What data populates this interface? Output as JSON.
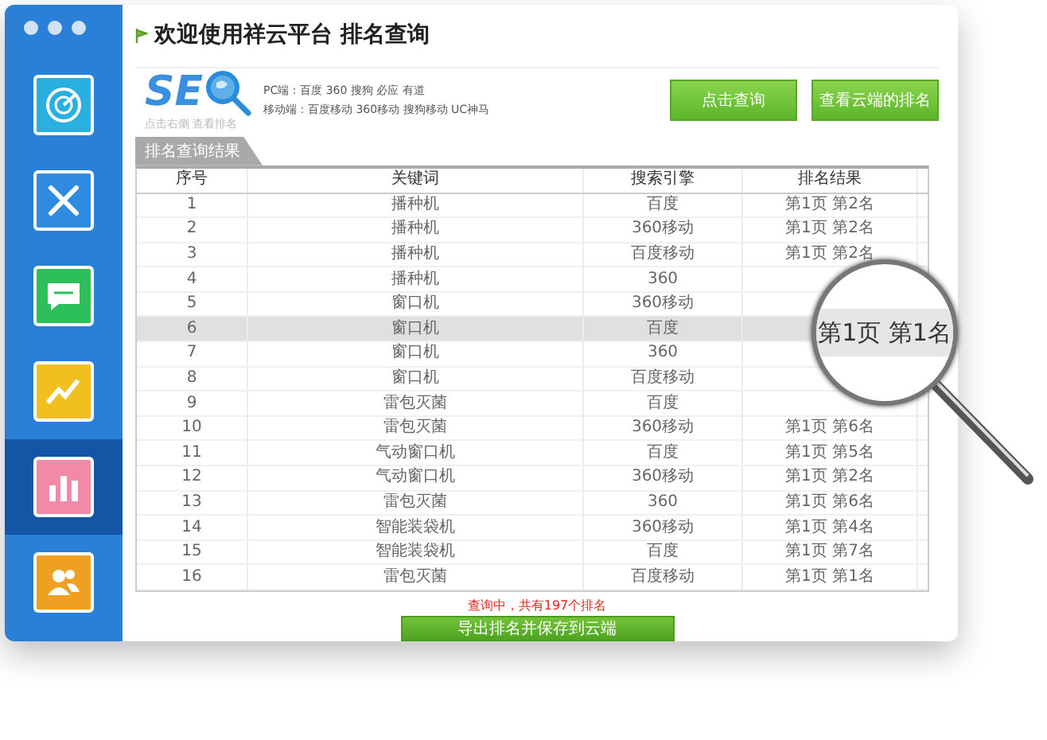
{
  "window": {
    "title": "欢迎使用祥云平台 排名查询"
  },
  "sidebar": {
    "items": [
      {
        "selected": false
      },
      {
        "selected": false
      },
      {
        "selected": false
      },
      {
        "selected": false
      },
      {
        "selected": true
      },
      {
        "selected": false
      }
    ]
  },
  "logo": {
    "text": "SE",
    "tagline": "点击右侧 查看排名"
  },
  "engines": [
    "PC端：百度 360 搜狗 必应 有道",
    "移动端：百度移动 360移动 搜狗移动 UC神马"
  ],
  "buttons": [
    "点击查询",
    "查看云端的排名"
  ],
  "tab": {
    "label": "排名查询结果"
  },
  "table": {
    "columns": [
      "序号",
      "关键词",
      "搜索引擎",
      "排名结果"
    ],
    "rows": [
      {
        "cells": [
          "1",
          "播种机",
          "百度",
          "第1页 第2名"
        ],
        "selected": false
      },
      {
        "cells": [
          "2",
          "播种机",
          "360移动",
          "第1页 第2名"
        ],
        "selected": false
      },
      {
        "cells": [
          "3",
          "播种机",
          "百度移动",
          "第1页 第2名"
        ],
        "selected": false
      },
      {
        "cells": [
          "4",
          "播种机",
          "360"
        ],
        "selected": false
      },
      {
        "cells": [
          "5",
          "窗口机",
          "360移动"
        ],
        "selected": false
      },
      {
        "cells": [
          "6",
          "窗口机",
          "百度"
        ],
        "selected": true
      },
      {
        "cells": [
          "7",
          "窗口机",
          "360"
        ],
        "selected": false
      },
      {
        "cells": [
          "8",
          "窗口机",
          "百度移动"
        ],
        "selected": false
      },
      {
        "cells": [
          "9",
          "雷包灭菌",
          "百度"
        ],
        "selected": false
      },
      {
        "cells": [
          "10",
          "雷包灭菌",
          "360移动",
          "第1页 第6名"
        ],
        "selected": false
      },
      {
        "cells": [
          "11",
          "气动窗口机",
          "百度",
          "第1页 第5名"
        ],
        "selected": false
      },
      {
        "cells": [
          "12",
          "气动窗口机",
          "360移动",
          "第1页 第2名"
        ],
        "selected": false
      },
      {
        "cells": [
          "13",
          "雷包灭菌",
          "360",
          "第1页 第6名"
        ],
        "selected": false
      },
      {
        "cells": [
          "14",
          "智能装袋机",
          "360移动",
          "第1页 第4名"
        ],
        "selected": false
      },
      {
        "cells": [
          "15",
          "智能装袋机",
          "百度",
          "第1页 第7名"
        ],
        "selected": false
      },
      {
        "cells": [
          "16",
          "雷包灭菌",
          "百度移动",
          "第1页 第1名"
        ],
        "selected": false
      }
    ]
  },
  "status": "查询中，共有197个排名",
  "export_button": "导出排名并保存到云端",
  "magnifier": {
    "text": "第1页 第1名"
  }
}
